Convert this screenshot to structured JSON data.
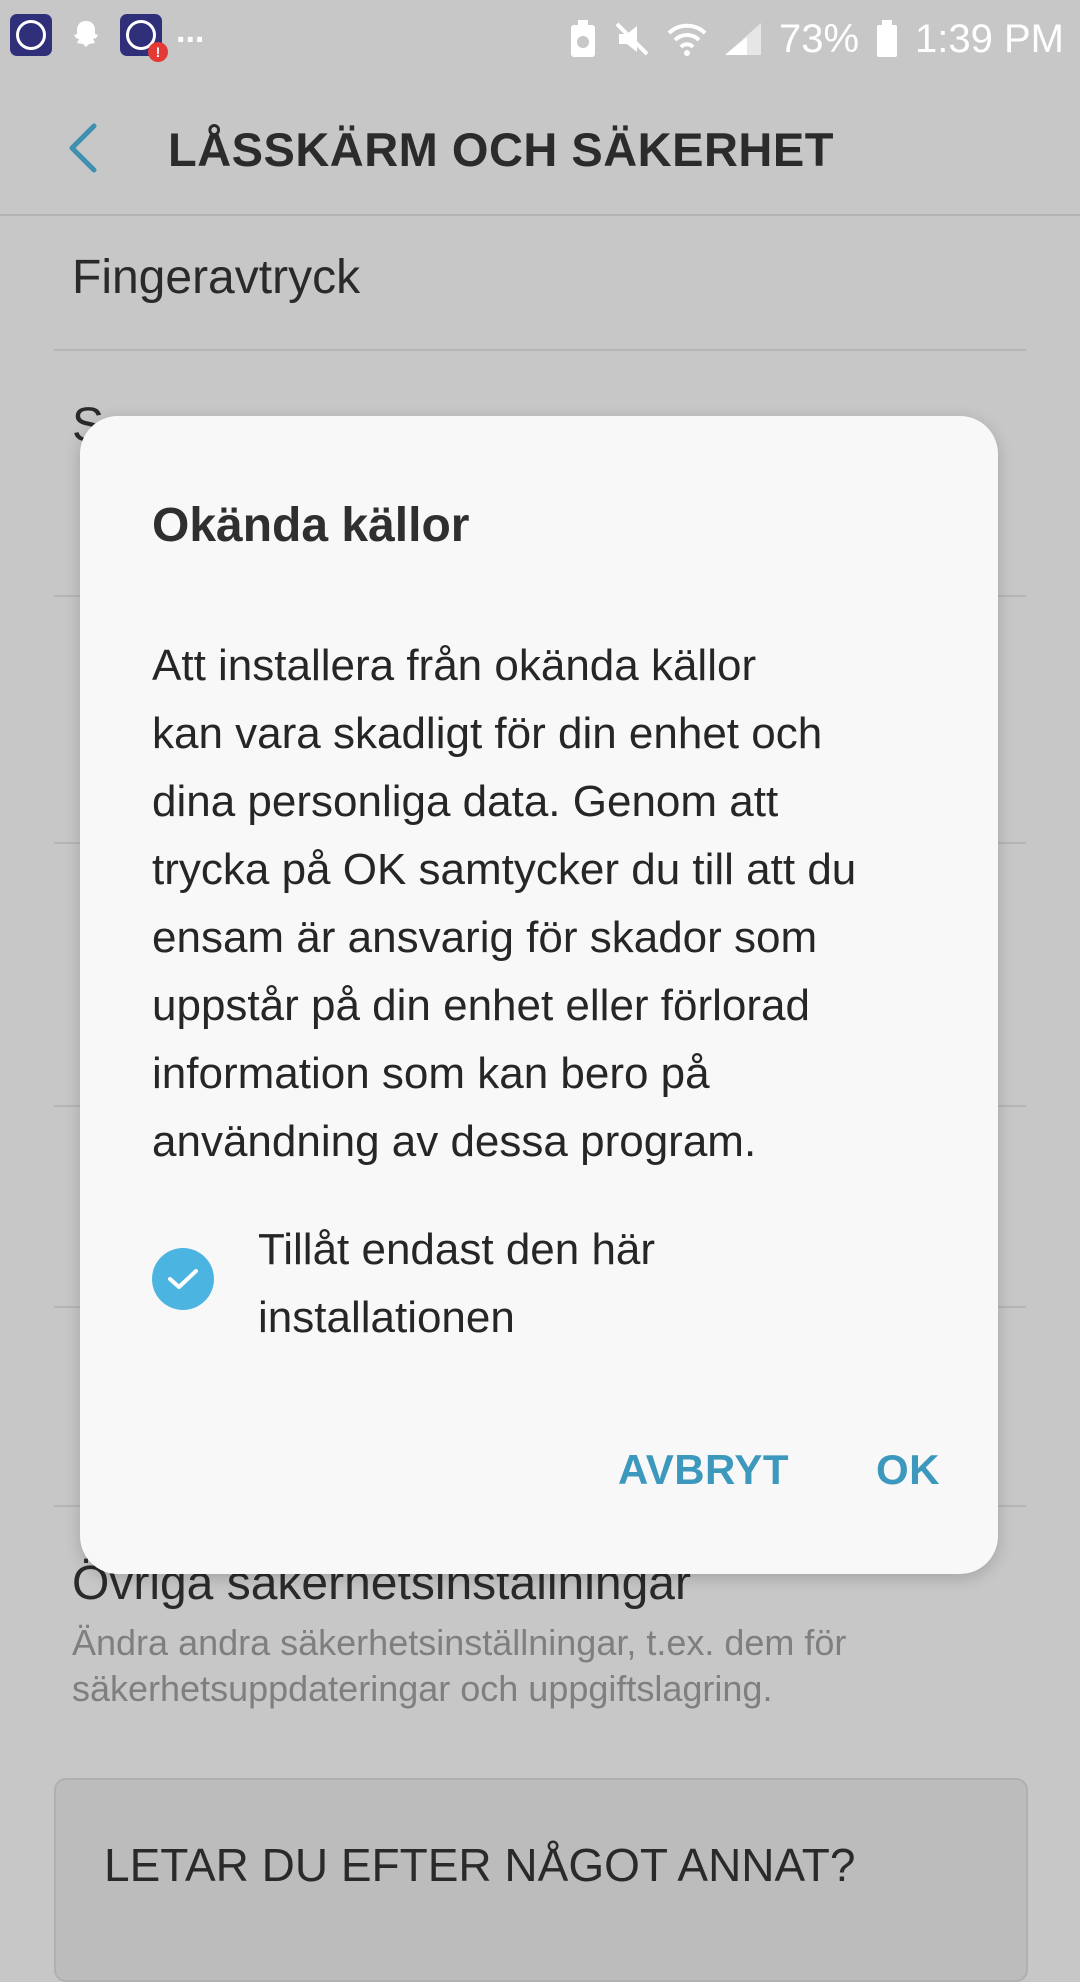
{
  "status_bar": {
    "battery": "73%",
    "time": "1:39 PM",
    "more": "..."
  },
  "header": {
    "title": "LÅSSKÄRM OCH SÄKERHET"
  },
  "list": {
    "row1_title": "Fingeravtryck",
    "row2_title": "S",
    "row3_title": "Övriga säkerhetsinställningar",
    "row3_sub_1": "Ändra andra säkerhetsinställningar, t.ex. dem för",
    "row3_sub_2": "säkerhetsuppdateringar och uppgiftslagring.",
    "help_card": "LETAR DU EFTER NÅGOT ANNAT?"
  },
  "dialog": {
    "title": "Okända källor",
    "body_lines": [
      "Att installera från okända källor",
      "kan vara skadligt för din enhet och",
      "dina personliga data. Genom att",
      "trycka på OK samtycker du till att du",
      "ensam är ansvarig för skador som",
      "uppstår på din enhet eller förlorad",
      "information som kan bero på",
      "användning av dessa program."
    ],
    "checkbox_line1": "Tillåt endast den här",
    "checkbox_line2": "installationen",
    "checkbox_checked": true,
    "cancel_label": "AVBRYT",
    "ok_label": "OK"
  },
  "colors": {
    "accent": "#3d98bd",
    "checkbox": "#4cb4e0",
    "dim_background": "#c7c7c7"
  }
}
